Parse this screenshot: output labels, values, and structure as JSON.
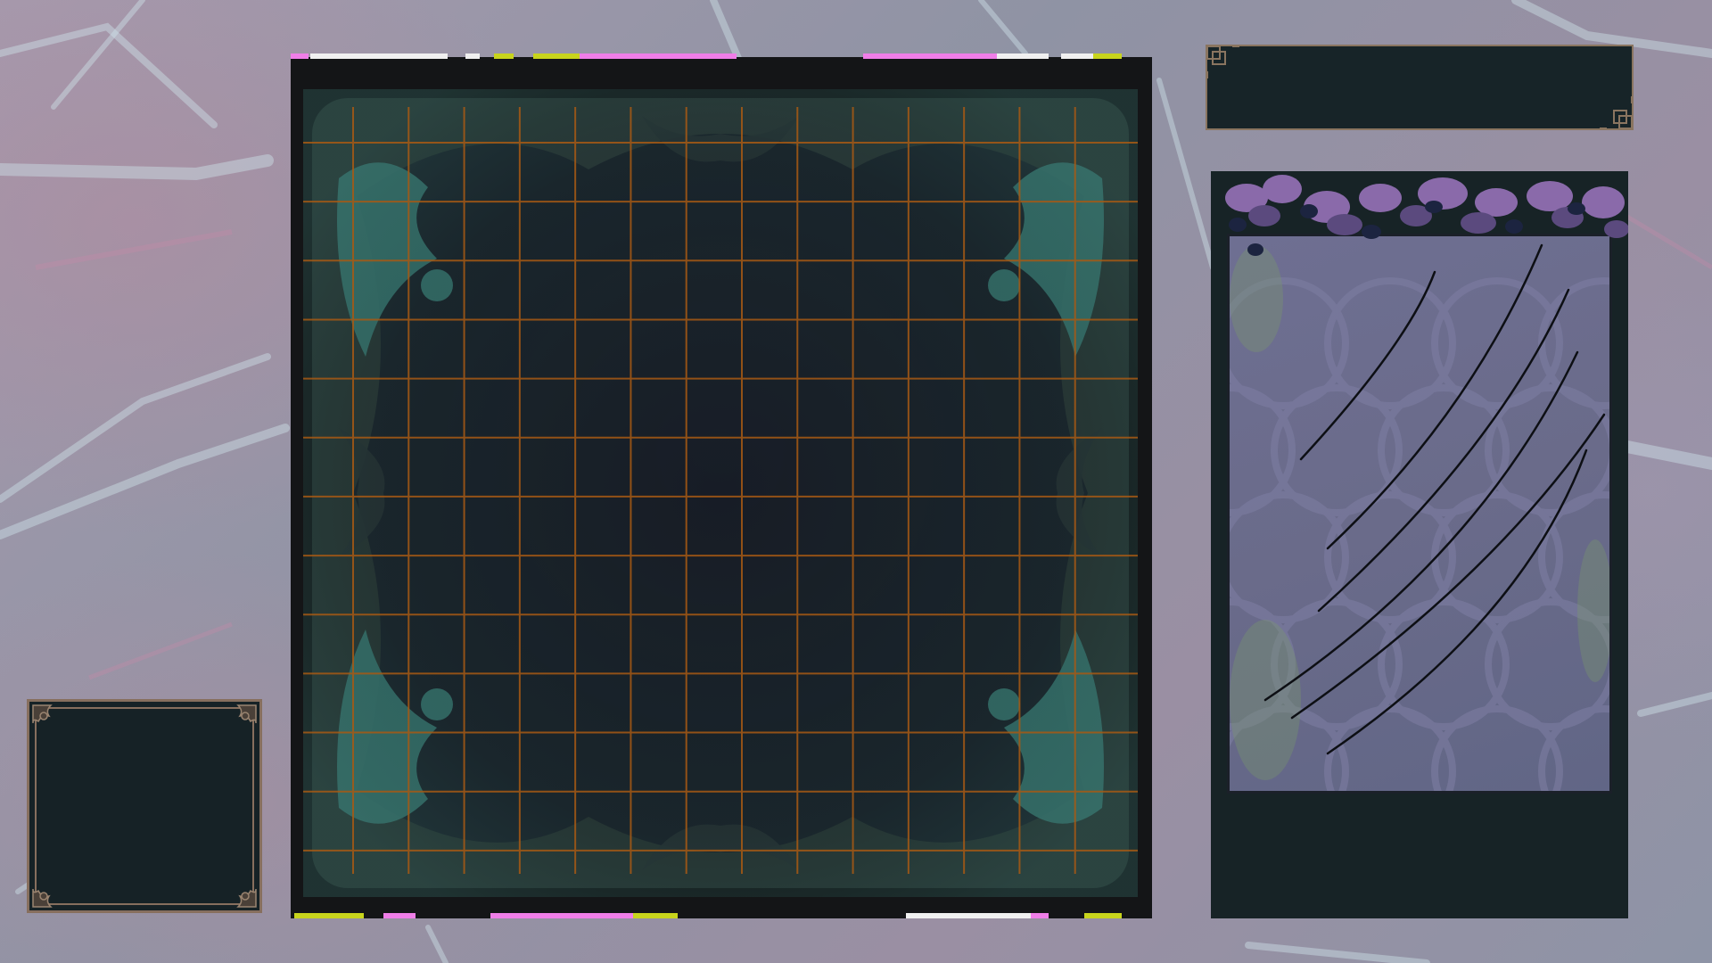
{
  "screen": {
    "colors": {
      "background": "#9498a8",
      "board_frame": "#141517",
      "grid_line": "#a85a14",
      "ornament": "#2f6660",
      "panel_bg": "#172428",
      "panel_border": "#8a7560",
      "accent_pink": "#f07ee8",
      "accent_white": "#f0f0f0",
      "accent_yellow": "#c8d41c",
      "card_art": "#6a6b8a",
      "leaves": "#7a5a9a"
    }
  },
  "board": {
    "grid_columns": 13,
    "grid_rows": 12
  },
  "icons": {
    "board_ornament": "floral-ornament-icon",
    "panel_corner": "corner-bracket-icon",
    "mini_corner": "filigree-corner-icon",
    "leaves": "leaf-cluster-icon"
  }
}
